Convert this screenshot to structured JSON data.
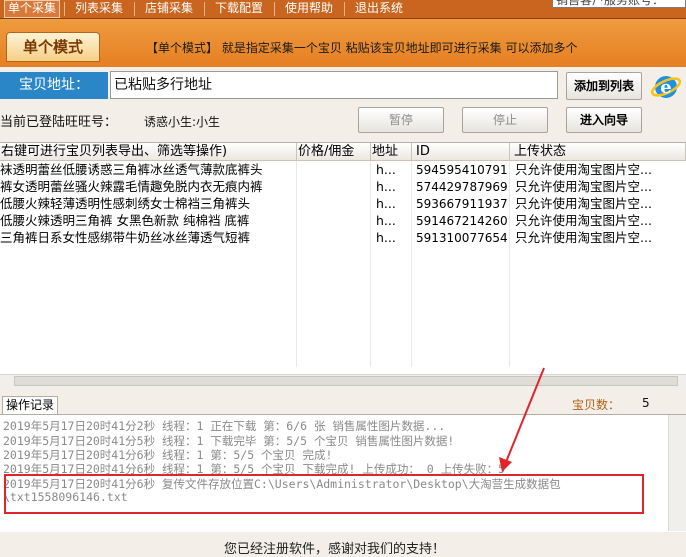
{
  "menubar": {
    "items": [
      "单个采集",
      "列表采集",
      "店铺采集",
      "下载配置",
      "使用帮助",
      "退出系统"
    ],
    "account": "销售客户服务账号："
  },
  "mode": {
    "tab_label": "单个模式",
    "description": "【单个模式】 就是指定采集一个宝贝  粘贴该宝贝地址即可进行采集  可以添加多个"
  },
  "url_row": {
    "label": "宝贝地址：",
    "value": "已粘贴多行地址",
    "add_button": "添加到列表"
  },
  "login_row": {
    "label": "当前已登陆旺旺号：",
    "user": "诱惑小生:小生",
    "pause_button": "暂停",
    "stop_button": "停止",
    "wizard_button": "进入向导"
  },
  "table": {
    "headers": [
      "右键可进行宝贝列表导出、筛选等操作)",
      "价格/佣金",
      "地址",
      "ID",
      "上传状态"
    ],
    "rows": [
      [
        "袜透明蕾丝低腰诱惑三角裤冰丝透气薄款底裤头",
        "",
        "h...",
        "594595410791",
        "只允许使用淘宝图片空..."
      ],
      [
        "裤女透明蕾丝骚火辣露毛情趣免脱内衣无痕内裤",
        "",
        "h...",
        "574429787969",
        "只允许使用淘宝图片空..."
      ],
      [
        "低腰火辣轻薄透明性感刺绣女士棉裆三角裤头",
        "",
        "h...",
        "593667911937",
        "只允许使用淘宝图片空..."
      ],
      [
        "低腰火辣透明三角裤 女黑色新款 纯棉裆 底裤",
        "",
        "h...",
        "591467214260",
        "只允许使用淘宝图片空..."
      ],
      [
        "三角裤日系女性感绑带牛奶丝冰丝薄透气短裤",
        "",
        "h...",
        "591310077654",
        "只允许使用淘宝图片空..."
      ]
    ]
  },
  "log": {
    "tab_label": "操作记录",
    "count_label": "宝贝数：",
    "count_value": "5",
    "lines": [
      "2019年5月17日20时41分2秒 线程：1  正在下载 第：6/6  张 销售属性图片数据...",
      "2019年5月17日20时41分5秒 线程：1  下载完毕 第：5/5  个宝贝   销售属性图片数据!",
      "2019年5月17日20时41分6秒 线程：1 第：5/5 个宝贝 完成!",
      "2019年5月17日20时41分6秒 线程：1 第：5/5 个宝贝 下载完成! 上传成功： 0  上传失败：5",
      "2019年5月17日20时41分6秒  复传文件存放位置C:\\Users\\Administrator\\Desktop\\大淘营生成数据包",
      "\\txt1558096146.txt"
    ]
  },
  "footer": {
    "text": "您已经注册软件，感谢对我们的支持！"
  },
  "colors": {
    "menubar": "#c9651f",
    "band": "#e57f22",
    "label_blue": "#2a86c7",
    "highlight": "#e2242b"
  }
}
